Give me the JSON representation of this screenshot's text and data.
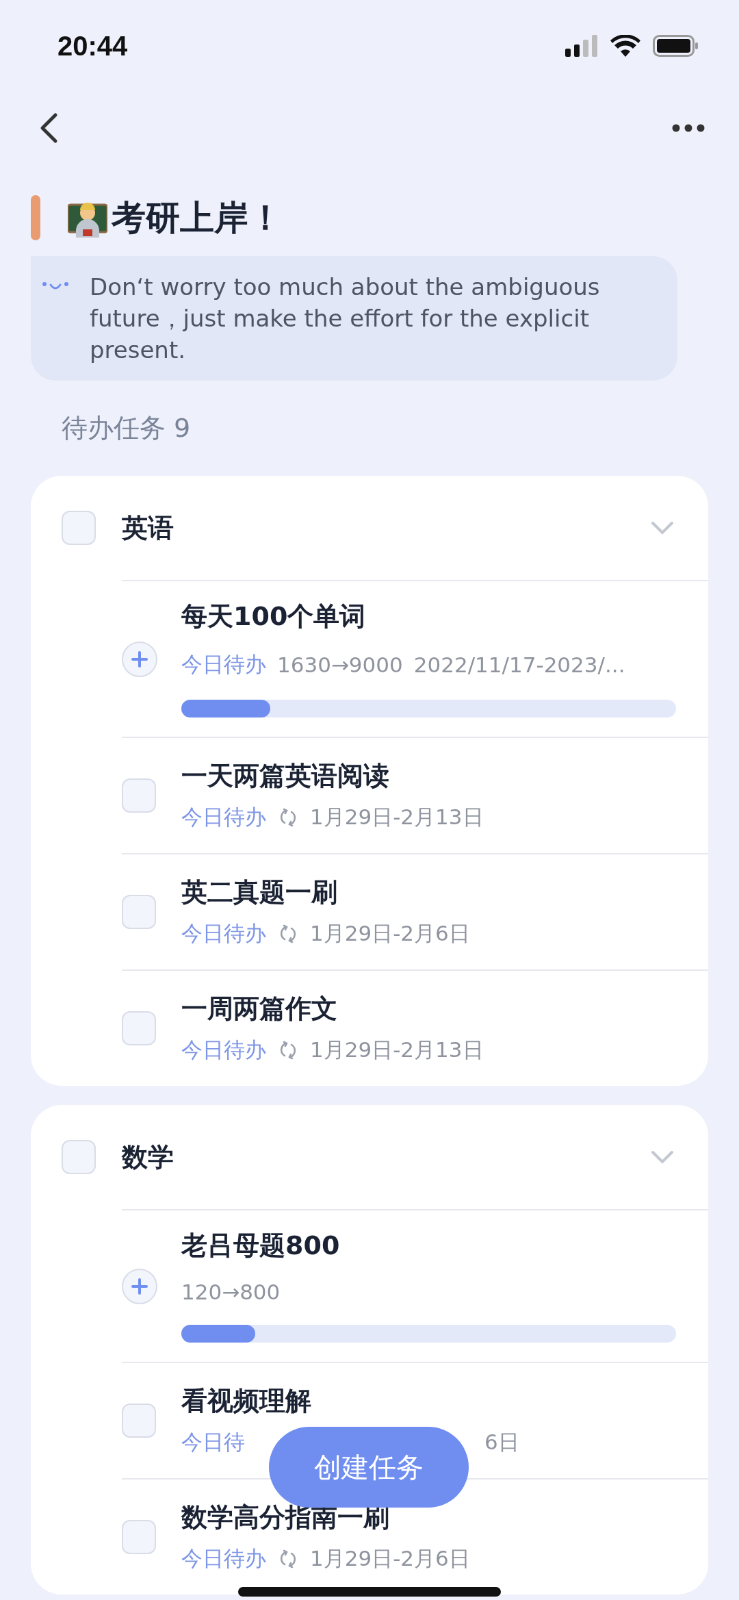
{
  "status_bar": {
    "time": "20:44"
  },
  "header": {
    "title": "考研上岸！",
    "quote": "Don‘t worry too much about the ambiguous future，just make the effort for the explicit present."
  },
  "section": {
    "label": "待办任务 9"
  },
  "groups": [
    {
      "name": "英语",
      "checked": false,
      "expanded": true,
      "tasks": [
        {
          "kind": "progress",
          "title": "每天100个单词",
          "tag": "今日待办",
          "count": "1630→9000",
          "range": "2022/11/17-2023/...",
          "level": 0.18
        },
        {
          "kind": "check",
          "title": "一天两篇英语阅读",
          "checked": false,
          "tag": "今日待办",
          "date": "1月29日-2月13日"
        },
        {
          "kind": "check",
          "title": "英二真题一刷",
          "checked": false,
          "tag": "今日待办",
          "date": "1月29日-2月6日"
        },
        {
          "kind": "check",
          "title": "一周两篇作文",
          "checked": false,
          "tag": "今日待办",
          "date": "1月29日-2月13日"
        }
      ]
    },
    {
      "name": "数学",
      "checked": false,
      "expanded": true,
      "tasks": [
        {
          "kind": "progress",
          "title": "老吕母题800",
          "count": "120→800",
          "level": 0.15
        },
        {
          "kind": "covered",
          "title": "看视频理解",
          "checked": false,
          "tag": "今日待",
          "date": "6日"
        },
        {
          "kind": "check",
          "title": "数学高分指南一刷",
          "checked": false,
          "tag": "今日待办",
          "date": "1月29日-2月6日"
        }
      ]
    }
  ],
  "fab": {
    "label": "创建任务"
  }
}
